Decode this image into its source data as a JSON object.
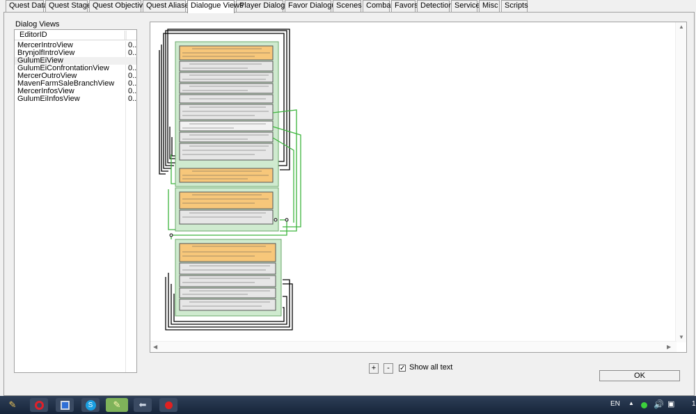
{
  "tabs": [
    {
      "label": "Quest Data",
      "active": false
    },
    {
      "label": "Quest Stages",
      "active": false
    },
    {
      "label": "Quest Objectives",
      "active": false
    },
    {
      "label": "Quest Aliases",
      "active": false
    },
    {
      "label": "Dialogue Views",
      "active": true
    },
    {
      "label": "Player Dialogue",
      "active": false
    },
    {
      "label": "Favor Dialogue",
      "active": false
    },
    {
      "label": "Scenes",
      "active": false
    },
    {
      "label": "Combat",
      "active": false
    },
    {
      "label": "Favors",
      "active": false
    },
    {
      "label": "Detection",
      "active": false
    },
    {
      "label": "Service",
      "active": false
    },
    {
      "label": "Misc",
      "active": false
    },
    {
      "label": "Scripts",
      "active": false
    }
  ],
  "dialog_views": {
    "label": "Dialog Views",
    "column_header": "EditorID",
    "rows": [
      {
        "name": "MercerIntroView",
        "value": "0...",
        "selected": false
      },
      {
        "name": "BrynjolfIntroView",
        "value": "0...",
        "selected": false
      },
      {
        "name": "GulumEiView",
        "value": "",
        "selected": true
      },
      {
        "name": "GulumEiConfrontationView",
        "value": "0...",
        "selected": false
      },
      {
        "name": "MercerOutroView",
        "value": "0...",
        "selected": false
      },
      {
        "name": "MavenFarmSaleBranchView",
        "value": "0...",
        "selected": false
      },
      {
        "name": "MercerInfosView",
        "value": "0...",
        "selected": false
      },
      {
        "name": "GulumEiInfosView",
        "value": "0...",
        "selected": false
      }
    ]
  },
  "controls": {
    "zoom_in": "+",
    "zoom_out": "-",
    "show_all_text_label": "Show all text",
    "show_all_text_checked": "✓",
    "ok_label": "OK"
  },
  "tray": {
    "language": "EN",
    "clock": "1"
  },
  "icons": {
    "taskbar": [
      "feather-icon",
      "opera-icon",
      "save-icon",
      "skype-icon",
      "feather-active-icon",
      "arrow-icon",
      "record-icon"
    ],
    "tray": [
      "chevron-up-icon",
      "network-green-icon",
      "speaker-icon",
      "flag-icon"
    ]
  },
  "colors": {
    "green_group": "#cfeacf",
    "orange_node": "#f7c77a",
    "green_line": "#3cb43c"
  }
}
